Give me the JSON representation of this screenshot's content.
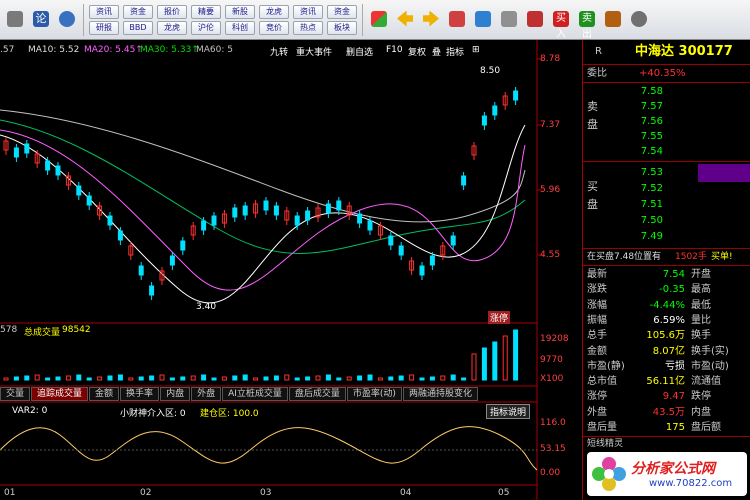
{
  "toolbar": {
    "buttons": [
      {
        "name": "home",
        "label": "",
        "color": "#7a7a7a"
      },
      {
        "name": "discuss",
        "label": "论",
        "color": "#2b5ca8"
      },
      {
        "name": "analysis",
        "label": "",
        "color": "#3a70c0"
      }
    ],
    "pairs": [
      [
        "资讯",
        "研报"
      ],
      [
        "资金",
        "BBD"
      ],
      [
        "报价",
        "龙虎"
      ],
      [
        "精要",
        "沪伦"
      ],
      [
        "新股",
        "科创"
      ],
      [
        "龙虎",
        "竞价"
      ],
      [
        "资讯",
        "热点"
      ],
      [
        "资金",
        "板块"
      ]
    ],
    "right_buttons": [
      "",
      "",
      "",
      "",
      "",
      "",
      "",
      "",
      "",
      "买入",
      "卖出",
      "",
      "",
      ""
    ]
  },
  "ma_bar": {
    "code": ".57",
    "items": [
      {
        "label": "MA10: 5.52",
        "color": "#ffffff"
      },
      {
        "label": "MA20: 5.45↑",
        "color": "#ff60ff"
      },
      {
        "label": "MA30: 5.33↑",
        "color": "#00e000"
      },
      {
        "label": "MA60: 5",
        "color": "#c0c0c0"
      }
    ],
    "events": [
      "九转",
      "重大事件",
      "删自选",
      "F10",
      "复权",
      "叠",
      "指标",
      "⊞"
    ]
  },
  "price_axis": [
    "8.78",
    "7.37",
    "5.96",
    "4.55",
    "19208",
    "9770",
    "X100"
  ],
  "chart_labels": {
    "high": "8.50",
    "low": "3.40",
    "tag": "涨停"
  },
  "volume_bar": {
    "left": "578",
    "label": "总成交量",
    "value": "98542",
    "color": "#ffff00"
  },
  "tabs_mid": [
    "交量",
    "追踪成交量",
    "金额",
    "换手率",
    "内盘",
    "外盘",
    "AI立桩成交量",
    "盘后成交量",
    "市盈率(动)",
    "两融通持股变化"
  ],
  "tabs_mid_active": 1,
  "indicator_bar": {
    "label": "VAR2: 0",
    "items": [
      "小财神介入区: 0",
      "建仓区: 100.0"
    ],
    "button": "指标说明"
  },
  "indicator_axis": [
    "116.0",
    "53.15",
    "0.00"
  ],
  "date_axis": [
    "01",
    "02",
    "03",
    "04",
    "05"
  ],
  "chart_data": {
    "type": "candlestick",
    "ylim": [
      3.0,
      8.78
    ],
    "high_label": 8.5,
    "low_label": 3.4
  },
  "panel": {
    "name": "中海达 300177",
    "header_code": "R",
    "ratio_label": "委比",
    "ratio_value": "+40.35%",
    "sell_label": "卖盘",
    "buy_label": "买盘",
    "sell": [
      {
        "p": "7.58"
      },
      {
        "p": "7.57"
      },
      {
        "p": "7.56"
      },
      {
        "p": "7.55"
      },
      {
        "p": "7.54"
      }
    ],
    "buy": [
      {
        "p": "7.53"
      },
      {
        "p": "7.52"
      },
      {
        "p": "7.51"
      },
      {
        "p": "7.50"
      },
      {
        "p": "7.49"
      }
    ],
    "notice": {
      "a": "在买盘7.48位置有",
      "b": "1502手",
      "c": "买单!"
    },
    "stats_left": [
      {
        "l": "最新",
        "v": "7.54",
        "c": "#00ff00"
      },
      {
        "l": "涨跌",
        "v": "-0.35",
        "c": "#00ff00"
      },
      {
        "l": "涨幅",
        "v": "-4.44%",
        "c": "#00ff00"
      },
      {
        "l": "振幅",
        "v": "6.59%",
        "c": "#ffffff"
      },
      {
        "l": "总手",
        "v": "105.6万",
        "c": "#ffff00"
      },
      {
        "l": "金额",
        "v": "8.07亿",
        "c": "#ffff00"
      },
      {
        "l": "市盈(静)",
        "v": "亏损",
        "c": "#ffffff"
      },
      {
        "l": "总市值",
        "v": "56.11亿",
        "c": "#ffff00"
      },
      {
        "l": "涨停",
        "v": "9.47",
        "c": "#ff3030"
      },
      {
        "l": "外盘",
        "v": "43.5万",
        "c": "#ff3030"
      },
      {
        "l": "盘后量",
        "v": "175",
        "c": "#ffff00"
      }
    ],
    "stats_right": [
      "开盘",
      "最高",
      "最低",
      "量比",
      "换手",
      "换手(实)",
      "市盈(动)",
      "流通值",
      "跌停",
      "内盘",
      "盘后额"
    ],
    "bottom": "短线精灵"
  },
  "watermark": "分析家公式网",
  "watermark_url": "www.70822.com"
}
